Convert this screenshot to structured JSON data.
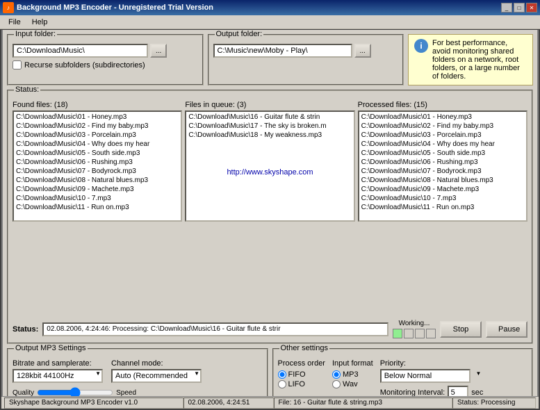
{
  "titleBar": {
    "title": "Background MP3 Encoder - Unregistered Trial Version",
    "icon": "♪"
  },
  "menu": {
    "items": [
      "File",
      "Help"
    ]
  },
  "inputFolder": {
    "label": "Input folder:",
    "value": "C:\\Download\\Music\\",
    "recurseLabel": "Recurse subfolders (subdirectories)",
    "browseLabel": "..."
  },
  "outputFolder": {
    "label": "Output folder:",
    "value": "C:\\Music\\new\\Moby - Play\\",
    "browseLabel": "..."
  },
  "infoBox": {
    "text": "For best performance, avoid monitoring shared folders on a network, root folders, or a large number of folders."
  },
  "status": {
    "sectionLabel": "Status:",
    "foundFiles": {
      "label": "Found files: (18)",
      "items": [
        "C:\\Download\\Music\\01 - Honey.mp3",
        "C:\\Download\\Music\\02 - Find my baby.mp3",
        "C:\\Download\\Music\\03 - Porcelain.mp3",
        "C:\\Download\\Music\\04 - Why does my hear",
        "C:\\Download\\Music\\05 - South side.mp3",
        "C:\\Download\\Music\\06 - Rushing.mp3",
        "C:\\Download\\Music\\07 - Bodyrock.mp3",
        "C:\\Download\\Music\\08 - Natural blues.mp3",
        "C:\\Download\\Music\\09 - Machete.mp3",
        "C:\\Download\\Music\\10 - 7.mp3",
        "C:\\Download\\Music\\11 - Run on.mp3"
      ]
    },
    "filesInQueue": {
      "label": "Files in queue: (3)",
      "items": [
        "C:\\Download\\Music\\16 - Guitar flute & strin",
        "C:\\Download\\Music\\17 - The sky is broken.m",
        "C:\\Download\\Music\\18 - My weakness.mp3"
      ],
      "link": "http://www.skyshape.com"
    },
    "processedFiles": {
      "label": "Processed files: (15)",
      "items": [
        "C:\\Download\\Music\\01 - Honey.mp3",
        "C:\\Download\\Music\\02 - Find my baby.mp3",
        "C:\\Download\\Music\\03 - Porcelain.mp3",
        "C:\\Download\\Music\\04 - Why does my hear",
        "C:\\Download\\Music\\05 - South side.mp3",
        "C:\\Download\\Music\\06 - Rushing.mp3",
        "C:\\Download\\Music\\07 - Bodyrock.mp3",
        "C:\\Download\\Music\\08 - Natural blues.mp3",
        "C:\\Download\\Music\\09 - Machete.mp3",
        "C:\\Download\\Music\\10 - 7.mp3",
        "C:\\Download\\Music\\11 - Run on.mp3"
      ]
    },
    "statusLabel": "Status:",
    "statusValue": "02.08.2006, 4:24:46: Processing: C:\\Download\\Music\\16 - Guitar flute & strir",
    "workingLabel": "Working...",
    "stopButton": "Stop",
    "pauseButton": "Pause"
  },
  "outputSettings": {
    "label": "Output MP3 Settings",
    "bitrateLabel": "Bitrate and samplerate:",
    "bitrateValue": "128kbit 44100Hz",
    "channelLabel": "Channel mode:",
    "channelValue": "Auto (Recommended)",
    "qualityLabel": "Quality",
    "speedLabel": "Speed"
  },
  "otherSettings": {
    "label": "Other settings",
    "processOrderLabel": "Process order",
    "fifoLabel": "FIFO",
    "lifoLabel": "LIFO",
    "inputFormatLabel": "Input format",
    "mp3Label": "MP3",
    "wavLabel": "Wav",
    "priorityLabel": "Priority:",
    "priorityValue": "Below Normal",
    "monitoringLabel": "Monitoring Interval:",
    "monitoringValue": "5",
    "secLabel": "sec"
  },
  "bottomStatus": {
    "app": "Skyshape Background MP3 Encoder v1.0",
    "time": "02.08.2006, 4:24:51",
    "file": "File: 16 - Guitar flute & string.mp3",
    "status": "Status: Processing"
  }
}
